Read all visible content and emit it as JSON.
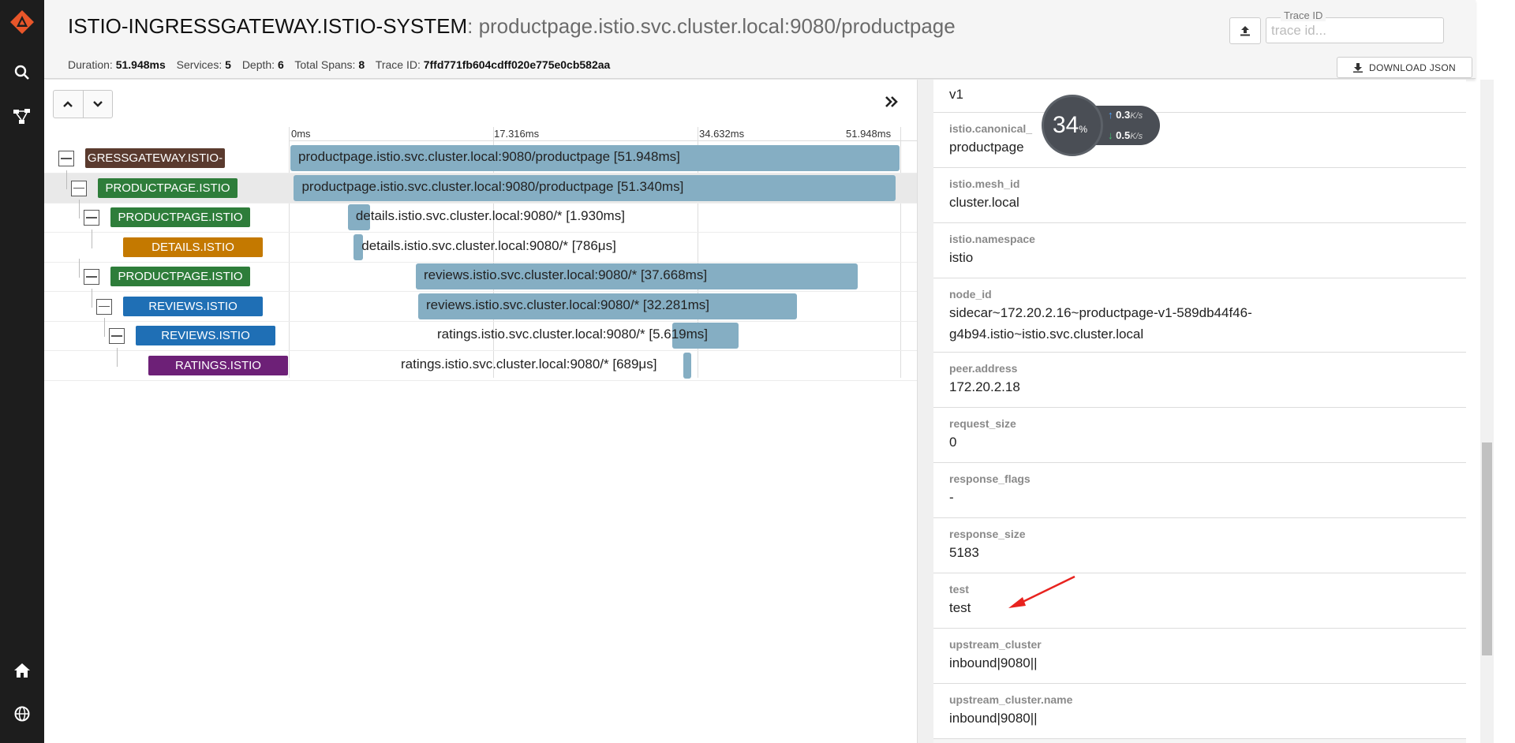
{
  "header": {
    "title": "ISTIO-INGRESSGATEWAY.ISTIO-SYSTEM",
    "subtitle": "productpage.istio.svc.cluster.local:9080/productpage",
    "duration_label": "Duration:",
    "duration_value": "51.948ms",
    "services_label": "Services:",
    "services_value": "5",
    "depth_label": "Depth:",
    "depth_value": "6",
    "spans_label": "Total Spans:",
    "spans_value": "8",
    "traceid_label": "Trace ID:",
    "traceid_value": "7ffd771fb604cdff020e775e0cb582aa",
    "search_label": "Trace ID",
    "search_placeholder": "trace id...",
    "download_label": "DOWNLOAD JSON"
  },
  "ticks": [
    "0ms",
    "17.316ms",
    "34.632ms",
    "51.948ms"
  ],
  "spans": [
    {
      "service": "GRESSGATEWAY.ISTIO-",
      "color": "#5a3a2e",
      "label": "productpage.istio.svc.cluster.local:9080/productpage [51.948ms]",
      "start": 0,
      "duration": 51.948
    },
    {
      "service": "PRODUCTPAGE.ISTIO",
      "color": "#2e7d3a",
      "label": "productpage.istio.svc.cluster.local:9080/productpage [51.340ms]",
      "start": 0.3,
      "duration": 51.34
    },
    {
      "service": "PRODUCTPAGE.ISTIO",
      "color": "#2e7d3a",
      "label": "details.istio.svc.cluster.local:9080/* [1.930ms]",
      "start": 4.9,
      "duration": 1.93
    },
    {
      "service": "DETAILS.ISTIO",
      "color": "#c47900",
      "label": "details.istio.svc.cluster.local:9080/* [786μs]",
      "start": 5.4,
      "duration": 0.786
    },
    {
      "service": "PRODUCTPAGE.ISTIO",
      "color": "#2e7d3a",
      "label": "reviews.istio.svc.cluster.local:9080/* [37.668ms]",
      "start": 10.7,
      "duration": 37.668
    },
    {
      "service": "REVIEWS.ISTIO",
      "color": "#1f6fb5",
      "label": "reviews.istio.svc.cluster.local:9080/* [32.281ms]",
      "start": 10.9,
      "duration": 32.281
    },
    {
      "service": "REVIEWS.ISTIO",
      "color": "#1f6fb5",
      "label": "ratings.istio.svc.cluster.local:9080/* [5.619ms]",
      "start": 32.6,
      "duration": 5.619
    },
    {
      "service": "RATINGS.ISTIO",
      "color": "#6d2077",
      "label": "ratings.istio.svc.cluster.local:9080/* [689μs]",
      "start": 33.5,
      "duration": 0.689
    }
  ],
  "tags": [
    {
      "key": "",
      "value": "v1"
    },
    {
      "key": "istio.canonical_",
      "value": "productpage"
    },
    {
      "key": "istio.mesh_id",
      "value": "cluster.local"
    },
    {
      "key": "istio.namespace",
      "value": "istio"
    },
    {
      "key": "node_id",
      "value": "sidecar~172.20.2.16~productpage-v1-589db44f46-g4b94.istio~istio.svc.cluster.local"
    },
    {
      "key": "peer.address",
      "value": "172.20.2.18"
    },
    {
      "key": "request_size",
      "value": "0"
    },
    {
      "key": "response_flags",
      "value": "-"
    },
    {
      "key": "response_size",
      "value": "5183"
    },
    {
      "key": "test",
      "value": "test"
    },
    {
      "key": "upstream_cluster",
      "value": "inbound|9080||"
    },
    {
      "key": "upstream_cluster.name",
      "value": "inbound|9080||"
    }
  ],
  "widget": {
    "percent": "34",
    "percent_unit": "%",
    "up": "0.3",
    "down": "0.5",
    "unit": "K/s"
  },
  "colors": {
    "bar": "#85aec3",
    "nav": "#1d1d1d",
    "logo": "#e8562a",
    "arrow": "#e8231f"
  }
}
